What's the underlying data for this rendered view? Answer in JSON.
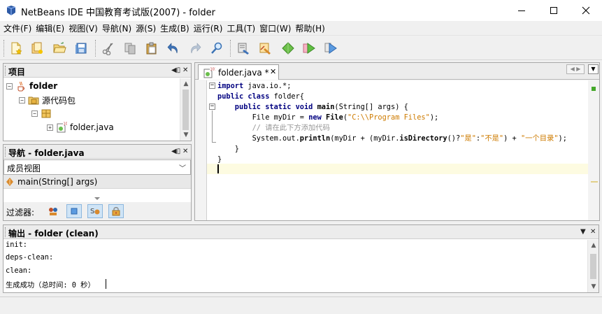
{
  "window": {
    "title": "NetBeans IDE 中国教育考试版(2007) - folder"
  },
  "menubar": {
    "items": [
      "文件(F)",
      "编辑(E)",
      "视图(V)",
      "导航(N)",
      "源(S)",
      "生成(B)",
      "运行(R)",
      "工具(T)",
      "窗口(W)",
      "帮助(H)"
    ]
  },
  "toolbar": {
    "buttons": [
      "new-file",
      "new-project",
      "open-project",
      "save-all",
      "cut",
      "copy",
      "paste",
      "undo",
      "redo",
      "find",
      "build-main-project",
      "clean-build",
      "run-main-project",
      "debug-main-project",
      "profile"
    ]
  },
  "projects": {
    "title": "项目",
    "tree": {
      "root": "folder",
      "source_packages": "源代码包",
      "file": "folder.java"
    }
  },
  "navigator": {
    "title": "导航 - folder.java",
    "view_select": "成员视图",
    "member": "main(String[] args)",
    "filters_label": "过滤器:"
  },
  "editor": {
    "tab_label": "folder.java *",
    "lines": [
      {
        "tokens": [
          {
            "t": "import",
            "c": "kw"
          },
          {
            "t": " java.io.*;",
            "c": ""
          }
        ]
      },
      {
        "tokens": [
          {
            "t": "public class",
            "c": "kw"
          },
          {
            "t": " folder{",
            "c": ""
          }
        ]
      },
      {
        "tokens": [
          {
            "t": "    public static void",
            "c": "kw"
          },
          {
            "t": " ",
            "c": ""
          },
          {
            "t": "main",
            "c": "meth"
          },
          {
            "t": "(String[] args) {",
            "c": ""
          }
        ]
      },
      {
        "tokens": [
          {
            "t": "        File myDir = ",
            "c": ""
          },
          {
            "t": "new",
            "c": "kw"
          },
          {
            "t": " ",
            "c": ""
          },
          {
            "t": "File",
            "c": "meth"
          },
          {
            "t": "(",
            "c": ""
          },
          {
            "t": "\"C:\\\\Program Files\"",
            "c": "str"
          },
          {
            "t": ");",
            "c": ""
          }
        ]
      },
      {
        "tokens": [
          {
            "t": "        // 请在此下方添加代码",
            "c": "cmt"
          }
        ]
      },
      {
        "tokens": [
          {
            "t": "        System.out.",
            "c": ""
          },
          {
            "t": "println",
            "c": "meth"
          },
          {
            "t": "(myDir + (myDir.",
            "c": ""
          },
          {
            "t": "isDirectory",
            "c": "meth"
          },
          {
            "t": "()?",
            "c": ""
          },
          {
            "t": "\"是\"",
            "c": "str"
          },
          {
            "t": ":",
            "c": ""
          },
          {
            "t": "\"不是\"",
            "c": "str"
          },
          {
            "t": ") + ",
            "c": ""
          },
          {
            "t": "\"一个目录\"",
            "c": "str"
          },
          {
            "t": ");",
            "c": ""
          }
        ]
      },
      {
        "tokens": [
          {
            "t": "    }",
            "c": ""
          }
        ]
      },
      {
        "tokens": [
          {
            "t": "}",
            "c": ""
          }
        ]
      }
    ]
  },
  "output": {
    "title": "输出 - folder (clean)",
    "lines": [
      "init:",
      "deps-clean:",
      "clean:",
      "生成成功（总时间: 0 秒）"
    ]
  },
  "colors": {
    "keyword": "#000080",
    "string": "#ce7b00",
    "comment": "#969696",
    "current_line": "#fdfbe1"
  }
}
